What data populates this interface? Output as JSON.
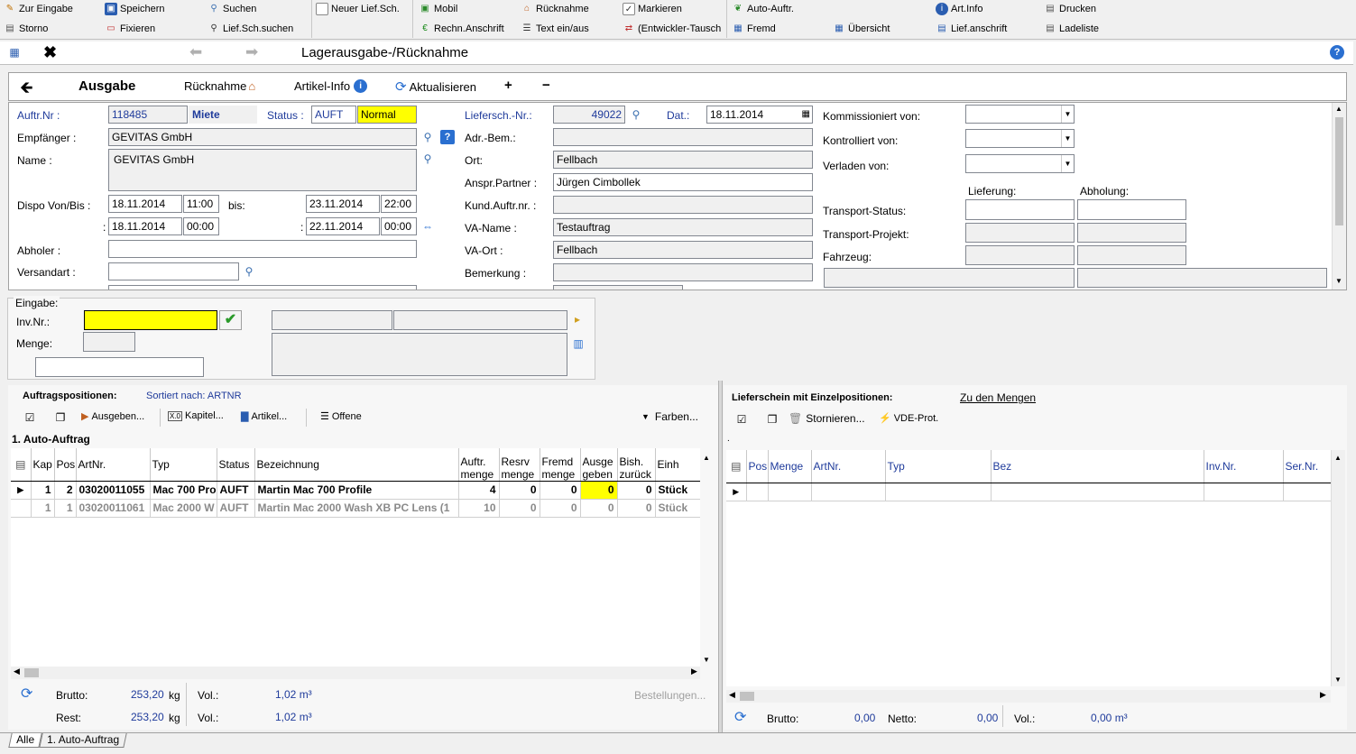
{
  "toolbar": {
    "zur_eingabe": "Zur Eingabe",
    "storno": "Storno",
    "speichern": "Speichern",
    "fixieren": "Fixieren",
    "suchen": "Suchen",
    "liefsch_suchen": "Lief.Sch.suchen",
    "neuer_liefsch": "Neuer Lief.Sch.",
    "mobil": "Mobil",
    "rechn_anschrift": "Rechn.Anschrift",
    "ruecknahme": "Rücknahme",
    "text_ein_aus": "Text ein/aus",
    "markieren": "Markieren",
    "entwickler_tausch": "(Entwickler-Tausch",
    "auto_auftr": "Auto-Auftr.",
    "fremd": "Fremd",
    "uebersicht": "Übersicht",
    "art_info": "Art.Info",
    "lief_anschrift": "Lief.anschrift",
    "drucken": "Drucken",
    "ladeliste": "Ladeliste"
  },
  "titlebar": {
    "title": "Lagerausgabe-/Rücknahme"
  },
  "actionbar": {
    "ausgabe": "Ausgabe",
    "ruecknahme": "Rücknahme",
    "artikel_info": "Artikel-Info",
    "aktualisieren": "Aktualisieren",
    "plus": "+",
    "minus": "−"
  },
  "form": {
    "auftr_nr_label": "Auftr.Nr :",
    "auftr_nr": "118485",
    "miete": "Miete",
    "status_label": "Status :",
    "status": "AUFT",
    "prio": "Normal",
    "empfaenger_label": "Empfänger :",
    "empfaenger": "GEVITAS GmbH",
    "name_label": "Name :",
    "name": "GEVITAS GmbH",
    "dispo_label": "Dispo Von/Bis :",
    "dispo_von_date1": "18.11.2014",
    "dispo_von_time1": "11:00",
    "bis_label": "bis:",
    "dispo_bis_date1": "23.11.2014",
    "dispo_bis_time1": "22:00",
    "colon": ":",
    "dispo_von_date2": "18.11.2014",
    "dispo_von_time2": "00:00",
    "dispo_bis_date2": "22.11.2014",
    "dispo_bis_time2": "00:00",
    "abholer_label": "Abholer :",
    "versandart_label": "Versandart :",
    "liefersch_label": "Liefersch.-Nr.:",
    "liefersch": "49022",
    "dat_label": "Dat.:",
    "dat": "18.11.2014",
    "adr_bem_label": "Adr.-Bem.:",
    "ort_label": "Ort:",
    "ort": "Fellbach",
    "anspr_label": "Anspr.Partner :",
    "anspr": "Jürgen Cimbollek",
    "kund_auftr_label": "Kund.Auftr.nr. :",
    "va_name_label": "VA-Name :",
    "va_name": "Testauftrag",
    "va_ort_label": "VA-Ort :",
    "va_ort": "Fellbach",
    "bemerkung_label": "Bemerkung :",
    "kommissioniert_label": "Kommissioniert von:",
    "kontrolliert_label": "Kontrolliert von:",
    "verladen_label": "Verladen von:",
    "lieferung_label": "Lieferung:",
    "abholung_label": "Abholung:",
    "transport_status_label": "Transport-Status:",
    "transport_projekt_label": "Transport-Projekt:",
    "fahrzeug_label": "Fahrzeug:"
  },
  "eingabe": {
    "group_label": "Eingabe:",
    "inv_nr_label": "Inv.Nr.:",
    "menge_label": "Menge:"
  },
  "left_panel": {
    "title": "Auftragspositionen:",
    "sort": "Sortiert nach: ARTNR",
    "btn_ausgeben": "Ausgeben...",
    "btn_kapitel": "Kapitel...",
    "btn_artikel": "Artikel...",
    "btn_offene": "Offene",
    "btn_farben": "Farben...",
    "group": "1. Auto-Auftrag",
    "columns": [
      "Kap",
      "Pos",
      "ArtNr.",
      "Typ",
      "Status",
      "Bezeichnung",
      "Auftr. menge",
      "Resrv menge",
      "Fremd menge",
      "Ausge geben",
      "Bish. zurück",
      "Einh"
    ],
    "rows": [
      [
        "1",
        "2",
        "03020011055",
        "Mac 700 Pro",
        "AUFT",
        "Martin Mac 700 Profile",
        "4",
        "0",
        "0",
        "0",
        "0",
        "Stück"
      ],
      [
        "1",
        "1",
        "03020011061",
        "Mac 2000 W",
        "AUFT",
        "Martin Mac 2000 Wash XB PC Lens (1",
        "10",
        "0",
        "0",
        "0",
        "0",
        "Stück"
      ]
    ],
    "brutto_label": "Brutto:",
    "brutto": "253,20",
    "kg": "kg",
    "vol_label": "Vol.:",
    "vol": "1,02 m³",
    "rest_label": "Rest:",
    "rest": "253,20",
    "rest_vol": "1,02 m³",
    "bestellungen": "Bestellungen..."
  },
  "right_panel": {
    "title": "Lieferschein mit Einzelpositionen:",
    "link": "Zu den Mengen",
    "btn_stornieren": "Stornieren...",
    "btn_vde": "VDE-Prot.",
    "columns": [
      "Pos",
      "Menge",
      "ArtNr.",
      "Typ",
      "Bez",
      "Inv.Nr.",
      "Ser.Nr."
    ],
    "brutto_label": "Brutto:",
    "brutto": "0,00",
    "netto_label": "Netto:",
    "netto": "0,00",
    "vol_label": "Vol.:",
    "vol": "0,00 m³"
  },
  "tabs": {
    "alle": "Alle",
    "auto": "1. Auto-Auftrag"
  },
  "colors": {
    "highlight": "#ffff00",
    "label_blue": "#1f3b9b"
  }
}
